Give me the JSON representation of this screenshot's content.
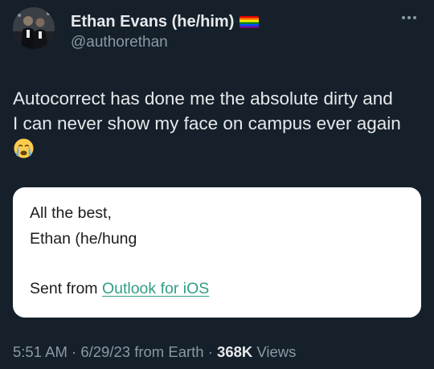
{
  "author": {
    "display_name": "Ethan Evans (he/him)",
    "handle": "@authorethan",
    "flag_icon": "rainbow-flag-icon",
    "avatar": "profile-photo"
  },
  "tweet": {
    "text_lines": [
      "Autocorrect has done me the absolute dirty and",
      "I can never show my face on campus ever again"
    ],
    "emoji_icon": "crying-face-icon"
  },
  "quoted_card": {
    "line1": "All the best,",
    "line2": "Ethan (he/hung",
    "sent_from_prefix": "Sent from ",
    "link_text": "Outlook for iOS",
    "link_color": "#2f9e87"
  },
  "meta": {
    "time": "5:51 AM",
    "separator": " · ",
    "date": "6/29/23",
    "source": " from Earth",
    "views_count": "368K",
    "views_label": " Views"
  },
  "more_icon": "more-horizontal-icon",
  "colors": {
    "background": "#15202b",
    "text": "#e7e9ea",
    "secondary_text": "#8b98a5",
    "card_background": "#ffffff"
  }
}
